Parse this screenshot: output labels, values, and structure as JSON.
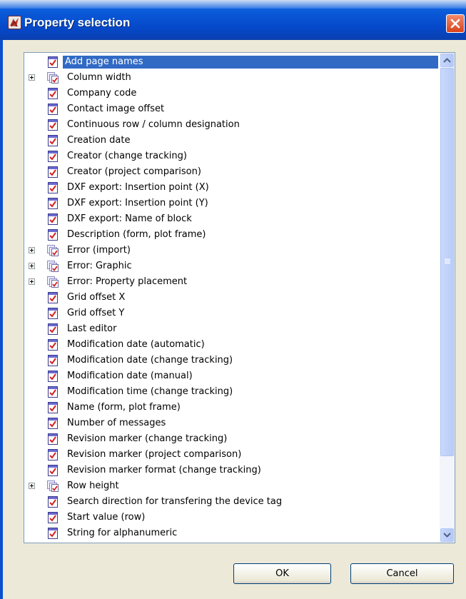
{
  "window": {
    "title": "Property selection"
  },
  "list": {
    "items": [
      {
        "label": "Add page names",
        "expandable": false,
        "selected": true
      },
      {
        "label": "Column width",
        "expandable": true
      },
      {
        "label": "Company code",
        "expandable": false
      },
      {
        "label": "Contact image offset",
        "expandable": false
      },
      {
        "label": "Continuous row / column designation",
        "expandable": false
      },
      {
        "label": "Creation date",
        "expandable": false
      },
      {
        "label": "Creator (change tracking)",
        "expandable": false
      },
      {
        "label": "Creator (project comparison)",
        "expandable": false
      },
      {
        "label": "DXF export: Insertion point (X)",
        "expandable": false
      },
      {
        "label": "DXF export: Insertion point (Y)",
        "expandable": false
      },
      {
        "label": "DXF export: Name of block",
        "expandable": false
      },
      {
        "label": "Description (form, plot frame)",
        "expandable": false
      },
      {
        "label": "Error (import)",
        "expandable": true
      },
      {
        "label": "Error: Graphic",
        "expandable": true
      },
      {
        "label": "Error: Property placement",
        "expandable": true
      },
      {
        "label": "Grid offset X",
        "expandable": false
      },
      {
        "label": "Grid offset Y",
        "expandable": false
      },
      {
        "label": "Last editor",
        "expandable": false
      },
      {
        "label": "Modification date (automatic)",
        "expandable": false
      },
      {
        "label": "Modification date (change tracking)",
        "expandable": false
      },
      {
        "label": "Modification date (manual)",
        "expandable": false
      },
      {
        "label": "Modification time (change tracking)",
        "expandable": false
      },
      {
        "label": "Name (form, plot frame)",
        "expandable": false
      },
      {
        "label": "Number of messages",
        "expandable": false
      },
      {
        "label": "Revision marker (change tracking)",
        "expandable": false
      },
      {
        "label": "Revision marker (project comparison)",
        "expandable": false
      },
      {
        "label": "Revision marker format (change tracking)",
        "expandable": false
      },
      {
        "label": "Row height",
        "expandable": true
      },
      {
        "label": "Search direction for transfering the device tag",
        "expandable": false
      },
      {
        "label": "Start value (row)",
        "expandable": false
      },
      {
        "label": "String for alphanumeric",
        "expandable": false
      }
    ]
  },
  "buttons": {
    "ok": "OK",
    "cancel": "Cancel"
  },
  "colors": {
    "titlebar": "#0548c9",
    "selection": "#316ac5",
    "close": "#d9421b"
  }
}
